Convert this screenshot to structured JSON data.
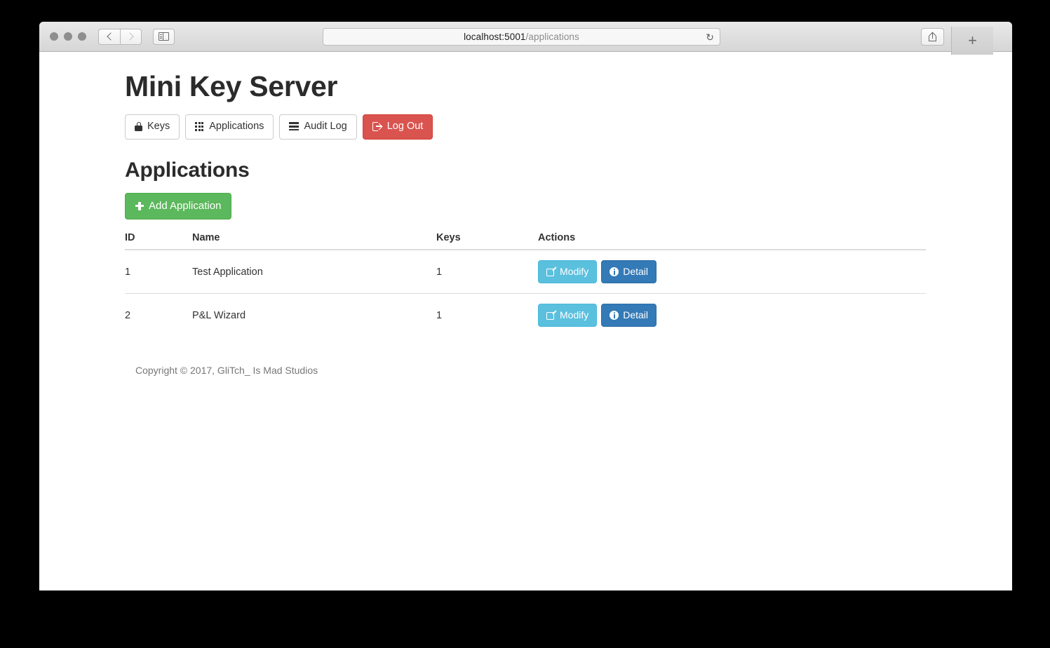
{
  "browser": {
    "url_host": "localhost:5001",
    "url_path": "/applications",
    "reload_icon": "reload-icon",
    "back_icon": "chevron-left-icon",
    "forward_icon": "chevron-right-icon",
    "sidebar_icon": "sidebar-toggle-icon",
    "share_icon": "share-icon",
    "tabs_icon": "tab-overview-icon",
    "new_tab_label": "+"
  },
  "site": {
    "title": "Mini Key Server"
  },
  "nav": {
    "items": [
      {
        "label": "Keys",
        "icon": "lock-icon",
        "style": "default"
      },
      {
        "label": "Applications",
        "icon": "grid-icon",
        "style": "default"
      },
      {
        "label": "Audit Log",
        "icon": "list-icon",
        "style": "default"
      },
      {
        "label": "Log Out",
        "icon": "signout-icon",
        "style": "danger"
      }
    ]
  },
  "main": {
    "heading": "Applications",
    "add_button": {
      "label": "Add Application",
      "icon": "plus-icon"
    }
  },
  "table": {
    "columns": [
      "ID",
      "Name",
      "Keys",
      "Actions"
    ],
    "rows": [
      {
        "id": "1",
        "name": "Test Application",
        "keys": "1",
        "actions": [
          {
            "label": "Modify",
            "icon": "pencil-square-icon",
            "style": "info"
          },
          {
            "label": "Detail",
            "icon": "info-circle-icon",
            "style": "primary"
          }
        ]
      },
      {
        "id": "2",
        "name": "P&L Wizard",
        "keys": "1",
        "actions": [
          {
            "label": "Modify",
            "icon": "pencil-square-icon",
            "style": "info"
          },
          {
            "label": "Detail",
            "icon": "info-circle-icon",
            "style": "primary"
          }
        ]
      }
    ]
  },
  "footer": {
    "text": "Copyright © 2017, GliTch_ Is Mad Studios"
  },
  "colors": {
    "danger": "#d9534f",
    "success": "#5cb85c",
    "info": "#5bc0de",
    "primary": "#337ab7",
    "border": "#dddddd",
    "text": "#333333",
    "muted": "#777777"
  }
}
